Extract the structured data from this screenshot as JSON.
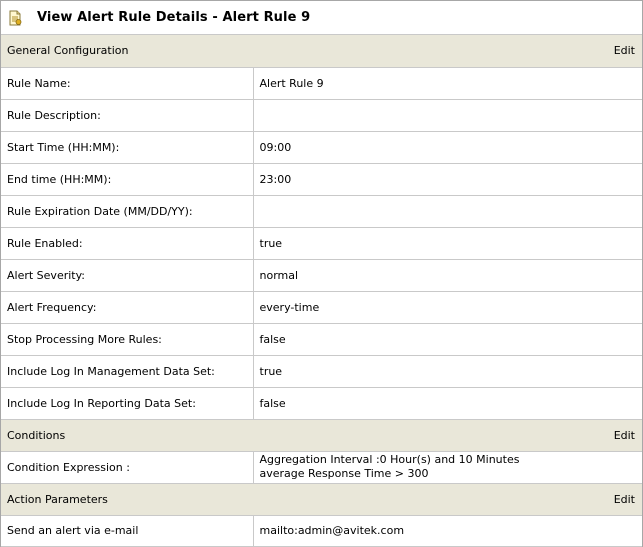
{
  "header": {
    "title": "View Alert Rule Details - Alert Rule 9",
    "icon": "document-icon"
  },
  "sections": {
    "general": {
      "title": "General Configuration",
      "edit_label": "Edit",
      "rows": [
        {
          "label": "Rule Name:",
          "value": "Alert Rule 9"
        },
        {
          "label": "Rule Description:",
          "value": ""
        },
        {
          "label": "Start Time (HH:MM):",
          "value": "09:00"
        },
        {
          "label": "End time (HH:MM):",
          "value": "23:00"
        },
        {
          "label": "Rule Expiration Date (MM/DD/YY):",
          "value": ""
        },
        {
          "label": "Rule Enabled:",
          "value": "true"
        },
        {
          "label": "Alert Severity:",
          "value": "normal"
        },
        {
          "label": "Alert Frequency:",
          "value": "every-time"
        },
        {
          "label": "Stop Processing More Rules:",
          "value": "false"
        },
        {
          "label": "Include Log In Management Data Set:",
          "value": "true"
        },
        {
          "label": "Include Log In Reporting Data Set:",
          "value": "false"
        }
      ]
    },
    "conditions": {
      "title": "Conditions",
      "edit_label": "Edit",
      "rows": [
        {
          "label": "Condition Expression :",
          "value_line1": "Aggregation Interval :0 Hour(s) and 10 Minutes",
          "value_line2": "average Response Time > 300"
        }
      ]
    },
    "actions": {
      "title": "Action Parameters",
      "edit_label": "Edit",
      "rows": [
        {
          "label": "Send an alert via e-mail",
          "value": "mailto:admin@avitek.com"
        }
      ]
    }
  },
  "colors": {
    "section_bg": "#e9e7d9",
    "border": "#c9c9c9"
  }
}
